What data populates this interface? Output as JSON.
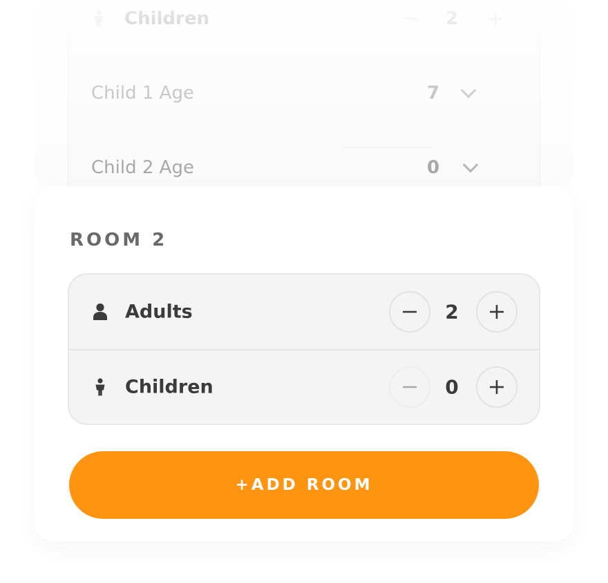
{
  "room1": {
    "children_label": "Children",
    "children_value": "2",
    "child_ages": [
      {
        "label": "Child 1 Age",
        "value": "7"
      },
      {
        "label": "Child 2 Age",
        "value": "0"
      }
    ]
  },
  "room2": {
    "title": "ROOM 2",
    "adults": {
      "label": "Adults",
      "value": "2",
      "icon": "person-icon"
    },
    "children": {
      "label": "Children",
      "value": "0",
      "icon": "child-icon"
    }
  },
  "add_room_label": "+ADD ROOM",
  "colors": {
    "accent": "#ff9410",
    "text_dark": "#3b3b3b",
    "title_gray": "#6a6a6a",
    "group_bg": "#f4f4f4"
  }
}
